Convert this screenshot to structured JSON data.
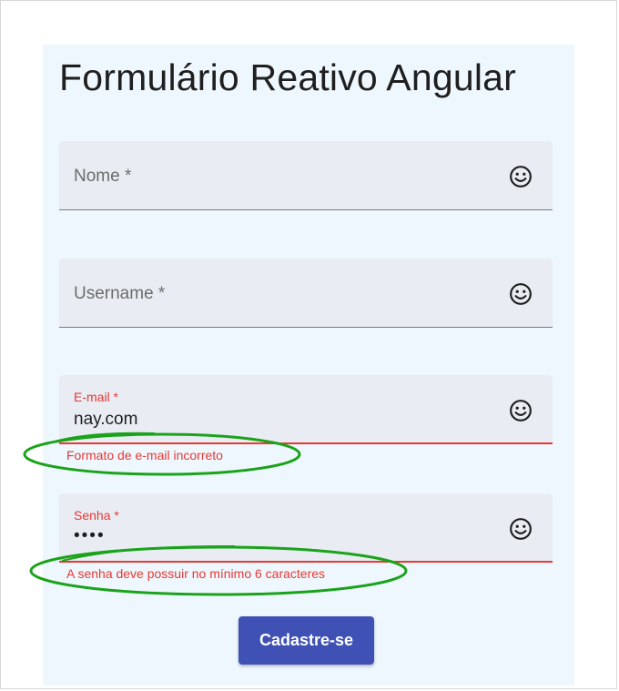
{
  "form": {
    "title": "Formulário Reativo Angular",
    "fields": [
      {
        "label": "Nome *",
        "value": "",
        "state": "empty",
        "icon": "smile-icon"
      },
      {
        "label": "Username *",
        "value": "",
        "state": "empty",
        "icon": "smile-icon"
      },
      {
        "label": "E-mail *",
        "value": "nay.com",
        "state": "invalid",
        "icon": "smile-icon",
        "error": "Formato de e-mail incorreto"
      },
      {
        "label": "Senha *",
        "value": "••••",
        "state": "invalid",
        "icon": "smile-icon",
        "error": "A senha deve possuir no mínimo 6 caracteres"
      }
    ],
    "submit_label": "Cadastre-se"
  },
  "colors": {
    "card_background": "#eef7fd",
    "field_background": "#e9edf3",
    "error": "#e53935",
    "primary_button": "#3f51b5",
    "annotation": "#1aa31a"
  }
}
